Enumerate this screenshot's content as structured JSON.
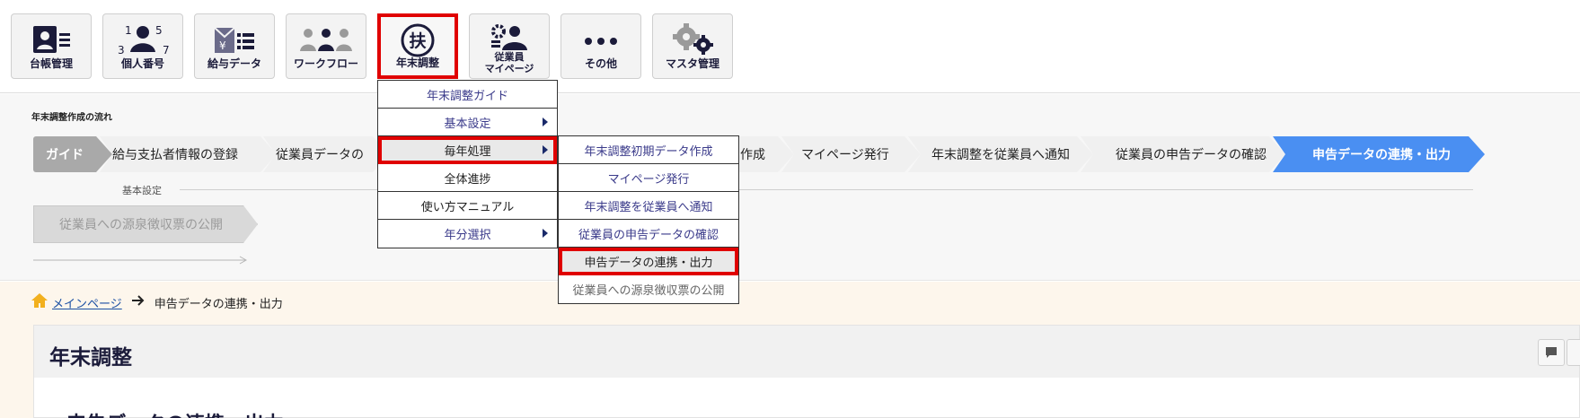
{
  "toolbar": {
    "buttons": [
      {
        "label": "台帳管理"
      },
      {
        "label": "個人番号"
      },
      {
        "label": "給与データ"
      },
      {
        "label": "ワークフロー"
      },
      {
        "label": "年末調整"
      },
      {
        "label_line1": "従業員",
        "label_line2": "マイページ"
      },
      {
        "label": "その他"
      },
      {
        "label": "マスタ管理"
      }
    ],
    "kojin_digits": [
      "1",
      "5",
      "3",
      "7"
    ],
    "fu_glyph": "扶",
    "yen_glyph": "¥"
  },
  "flow": {
    "title": "年末調整作成の流れ",
    "steps": [
      "ガイド",
      "給与支払者情報の登録",
      "従業員データの",
      "作成",
      "マイページ発行",
      "年末調整を従業員へ通知",
      "従業員の申告データの確認",
      "申告データの連携・出力"
    ],
    "basic_setting_label": "基本設定",
    "publish_step": "従業員への源泉徴収票の公開"
  },
  "menu_primary": [
    {
      "label": "年末調整ガイド"
    },
    {
      "label": "基本設定"
    },
    {
      "label": "毎年処理"
    },
    {
      "label": "全体進捗"
    },
    {
      "label": "使い方マニュアル"
    },
    {
      "label": "年分選択"
    }
  ],
  "menu_secondary": [
    {
      "label": "年末調整初期データ作成"
    },
    {
      "label": "マイページ発行"
    },
    {
      "label": "年末調整を従業員へ通知"
    },
    {
      "label": "従業員の申告データの確認"
    },
    {
      "label": "申告データの連携・出力"
    },
    {
      "label": "従業員への源泉徴収票の公開"
    }
  ],
  "breadcrumb": {
    "home": "メインページ",
    "current": "申告データの連携・出力"
  },
  "main": {
    "title": "年末調整",
    "subtitle": "申告データの連携・出力"
  },
  "colors": {
    "highlight": "#e00000",
    "active_step": "#4a8ff2",
    "navy": "#1b1b3a"
  }
}
